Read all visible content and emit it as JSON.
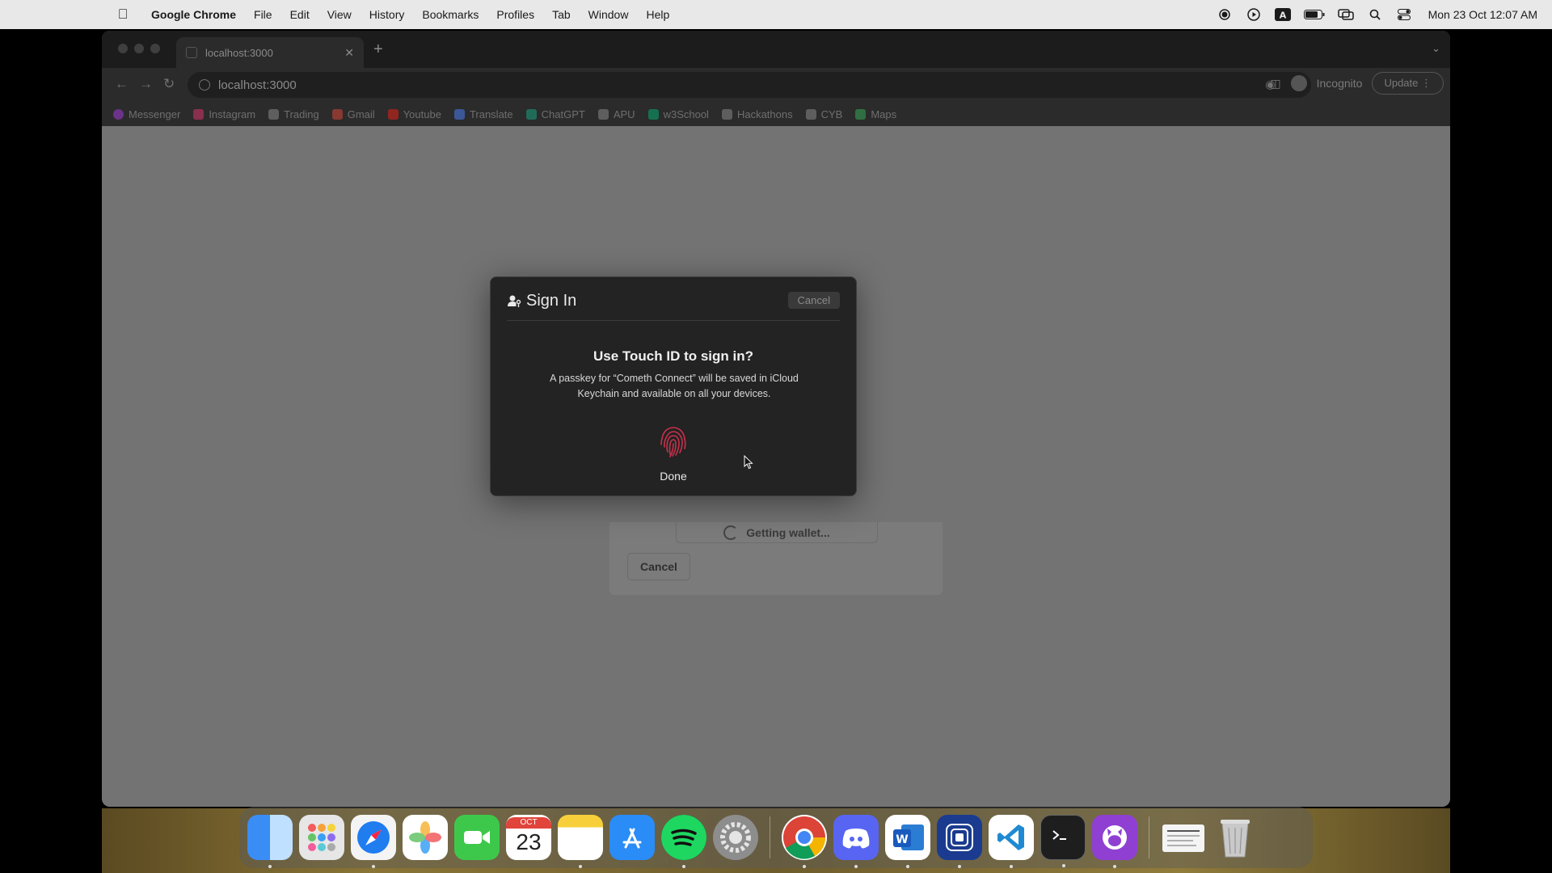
{
  "menubar": {
    "app_name": "Google Chrome",
    "items": [
      "File",
      "Edit",
      "View",
      "History",
      "Bookmarks",
      "Profiles",
      "Tab",
      "Window",
      "Help"
    ],
    "status_icons": [
      "record-icon",
      "play-circle-icon",
      "keyboard-a-icon",
      "battery-icon",
      "screen-mirror-icon",
      "search-icon",
      "control-center-icon"
    ],
    "clock": "Mon 23 Oct  12:07 AM"
  },
  "browser": {
    "tab_title": "localhost:3000",
    "url": "localhost:3000",
    "profile_label": "Incognito",
    "update_label": "Update",
    "bookmarks": [
      {
        "label": "Messenger",
        "color": "#a23bd6"
      },
      {
        "label": "Instagram",
        "color": "#d8336b"
      },
      {
        "label": "Trading",
        "color": "#888888"
      },
      {
        "label": "Gmail",
        "color": "#d44638"
      },
      {
        "label": "Youtube",
        "color": "#e62117"
      },
      {
        "label": "Translate",
        "color": "#4a7cf0"
      },
      {
        "label": "ChatGPT",
        "color": "#19a37f"
      },
      {
        "label": "APU",
        "color": "#888888"
      },
      {
        "label": "w3School",
        "color": "#04aa6d"
      },
      {
        "label": "Hackathons",
        "color": "#888888"
      },
      {
        "label": "CYB",
        "color": "#888888"
      },
      {
        "label": "Maps",
        "color": "#34a853"
      }
    ]
  },
  "page": {
    "status_text": "Getting wallet...",
    "cancel_label": "Cancel"
  },
  "modal": {
    "title": "Sign In",
    "cancel_label": "Cancel",
    "heading": "Use Touch ID to sign in?",
    "description": "A passkey for “Cometh Connect” will be saved in iCloud Keychain and available on all your devices.",
    "done_label": "Done",
    "accent_color": "#c8304a"
  },
  "dock": {
    "apps": [
      "finder-icon",
      "launchpad-icon",
      "safari-icon",
      "photos-icon",
      "facetime-icon",
      "calendar-icon",
      "notes-icon",
      "app-store-icon",
      "spotify-icon",
      "system-settings-icon",
      "chrome-icon",
      "discord-icon",
      "word-icon",
      "screen-recorder-icon",
      "vscode-icon",
      "terminal-icon",
      "github-desktop-icon",
      "documents-icon",
      "trash-icon"
    ],
    "calendar_month": "OCT",
    "calendar_day": "23"
  }
}
